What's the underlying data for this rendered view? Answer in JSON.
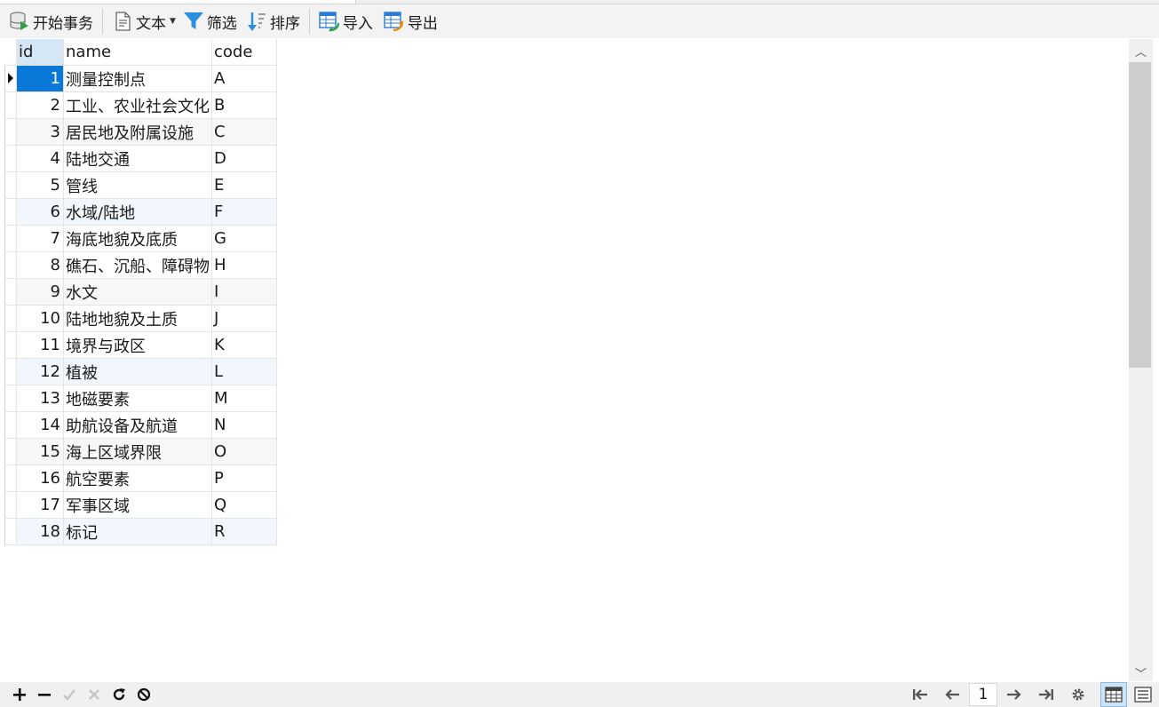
{
  "toolbar": {
    "begin_transaction": "开始事务",
    "text": "文本",
    "filter": "筛选",
    "sort": "排序",
    "import": "导入",
    "export": "导出"
  },
  "grid": {
    "columns": [
      "id",
      "name",
      "code"
    ],
    "rows": [
      {
        "id": "1",
        "name": "测量控制点",
        "code": "A"
      },
      {
        "id": "2",
        "name": "工业、农业社会文化",
        "code": "B"
      },
      {
        "id": "3",
        "name": "居民地及附属设施",
        "code": "C"
      },
      {
        "id": "4",
        "name": "陆地交通",
        "code": "D"
      },
      {
        "id": "5",
        "name": "管线",
        "code": "E"
      },
      {
        "id": "6",
        "name": "水域/陆地",
        "code": "F"
      },
      {
        "id": "7",
        "name": "海底地貌及底质",
        "code": "G"
      },
      {
        "id": "8",
        "name": "礁石、沉船、障碍物",
        "code": "H"
      },
      {
        "id": "9",
        "name": "水文",
        "code": "I"
      },
      {
        "id": "10",
        "name": "陆地地貌及土质",
        "code": "J"
      },
      {
        "id": "11",
        "name": "境界与政区",
        "code": "K"
      },
      {
        "id": "12",
        "name": "植被",
        "code": "L"
      },
      {
        "id": "13",
        "name": "地磁要素",
        "code": "M"
      },
      {
        "id": "14",
        "name": "助航设备及航道",
        "code": "N"
      },
      {
        "id": "15",
        "name": "海上区域界限",
        "code": "O"
      },
      {
        "id": "16",
        "name": "航空要素",
        "code": "P"
      },
      {
        "id": "17",
        "name": "军事区域",
        "code": "Q"
      },
      {
        "id": "18",
        "name": "标记",
        "code": "R"
      }
    ],
    "selected_row": 1
  },
  "pager": {
    "current_page": "1"
  },
  "colors": {
    "selection": "#0a78d7",
    "header_highlight": "#d5e6f7",
    "accent_blue": "#2b7cd3"
  }
}
